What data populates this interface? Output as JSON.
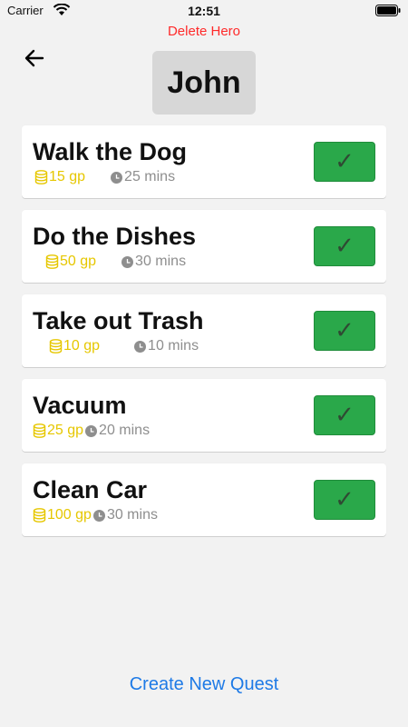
{
  "status_bar": {
    "carrier": "Carrier",
    "time": "12:51"
  },
  "header": {
    "delete_label": "Delete Hero",
    "hero_name": "John"
  },
  "quests": [
    {
      "title": "Walk the Dog",
      "reward": "15 gp",
      "duration": "25 mins"
    },
    {
      "title": "Do the Dishes",
      "reward": "50 gp",
      "duration": "30 mins"
    },
    {
      "title": "Take out Trash",
      "reward": "10 gp",
      "duration": "10 mins"
    },
    {
      "title": "Vacuum",
      "reward": "25 gp",
      "duration": "20 mins"
    },
    {
      "title": "Clean Car",
      "reward": "100 gp",
      "duration": "30 mins"
    }
  ],
  "complete_icon": "✓",
  "footer": {
    "create_label": "Create New Quest"
  },
  "colors": {
    "delete": "#ff2a2a",
    "gold": "#e6c700",
    "complete_button": "#2aa84a",
    "link": "#1e7ae6"
  }
}
